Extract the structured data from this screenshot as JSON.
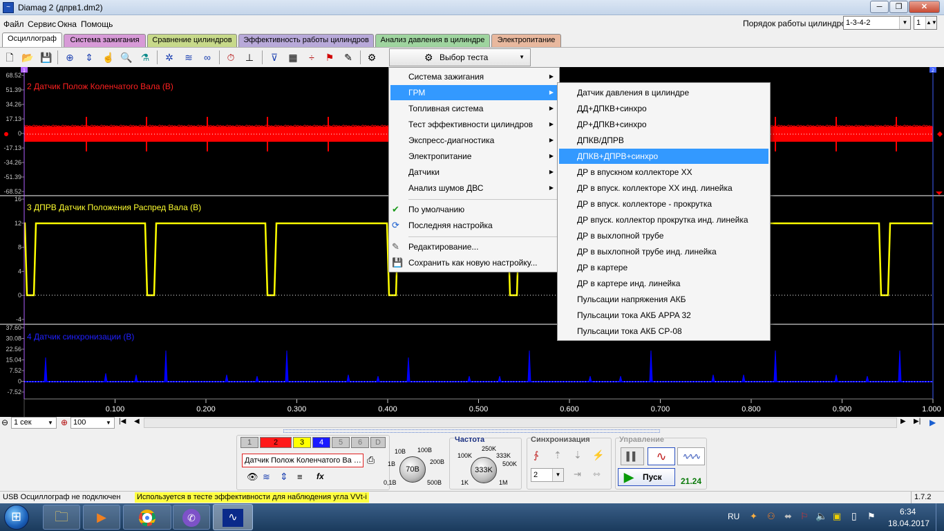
{
  "window": {
    "title": "Diamag 2 (дпрв1.dm2)",
    "minimize": "─",
    "maximize": "❐",
    "close": "✕"
  },
  "menubar": {
    "file": "Файл",
    "service": "Сервис",
    "windows": "Окна",
    "help": "Помощь"
  },
  "cylinder_order": {
    "label": "Порядок работы цилиндров",
    "value": "1-3-4-2",
    "count": "1"
  },
  "tabs": [
    {
      "label": "Осциллограф",
      "color": "#ffffff"
    },
    {
      "label": "Система зажигания",
      "color": "#d79ad7"
    },
    {
      "label": "Сравнение цилиндров",
      "color": "#c7d98a"
    },
    {
      "label": "Эффективность работы цилиндров",
      "color": "#b8a9d9"
    },
    {
      "label": "Анализ давления в цилиндре",
      "color": "#9fd49f"
    },
    {
      "label": "Электропитание",
      "color": "#e8b89e"
    }
  ],
  "test_select": {
    "label": "Выбор теста",
    "icon": "gear-icon"
  },
  "channels": {
    "ch2": {
      "title": "2 Датчик Полож Коленчатого Вала (В)",
      "color": "#ff0000",
      "yticks": [
        "68.52",
        "51.39",
        "34.26",
        "17.13",
        "0",
        "-17.13",
        "-34.26",
        "-51.39",
        "-68.52"
      ]
    },
    "ch3": {
      "title": "3 ДПРВ Датчик Положения Распред Вала (В)",
      "color": "#ffff00",
      "yticks": [
        "16",
        "12",
        "8",
        "4",
        "0",
        "-4"
      ]
    },
    "ch4": {
      "title": "4 Датчик синхронизации (В)",
      "color": "#0000ff",
      "yticks": [
        "37.60",
        "30.08",
        "22.56",
        "15.04",
        "7.52",
        "0",
        "-7.52"
      ]
    },
    "marker_left": "1",
    "marker_right": "2"
  },
  "xaxis": {
    "ticks": [
      "0.100",
      "0.200",
      "0.300",
      "0.400",
      "0.500",
      "0.600",
      "0.700",
      "0.800",
      "0.900",
      "1.000"
    ]
  },
  "scale": {
    "time": "1 сек",
    "zoom": "100"
  },
  "context_menu": {
    "items": [
      {
        "label": "Система зажигания",
        "submenu": true
      },
      {
        "label": "ГРМ",
        "submenu": true,
        "highlighted": true
      },
      {
        "label": "Топливная система",
        "submenu": true
      },
      {
        "label": "Тест эффективности цилиндров",
        "submenu": true
      },
      {
        "label": "Экспресс-диагностика",
        "submenu": true
      },
      {
        "label": "Электропитание",
        "submenu": true
      },
      {
        "label": "Датчики",
        "submenu": true
      },
      {
        "label": "Анализ шумов ДВС",
        "submenu": true
      }
    ],
    "actions": [
      {
        "label": "По умолчанию",
        "icon": "check-icon"
      },
      {
        "label": "Последняя настройка",
        "icon": "refresh-icon"
      },
      {
        "label": "Редактирование...",
        "icon": "edit-icon"
      },
      {
        "label": "Сохранить как новую настройку...",
        "icon": "save-icon"
      }
    ]
  },
  "submenu_grm": {
    "items": [
      "Датчик давления в цилиндре",
      "ДД+ДПКВ+синхро",
      "ДР+ДПКВ+синхро",
      "ДПКВ/ДПРВ",
      "ДПКВ+ДПРВ+синхро",
      "ДР в впускном коллекторе ХХ",
      "ДР в впуск. коллекторе ХХ инд. линейка",
      "ДР в впуск. коллекторе - прокрутка",
      "ДР впуск. коллектор прокрутка инд. линейка",
      "ДР в выхлопной трубе",
      "ДР в выхлопной трубе инд. линейка",
      "ДР в картере",
      "ДР в картере инд. линейка",
      "Пульсации напряжения АКБ",
      "Пульсации тока АКБ APPA 32",
      "Пульсации тока АКБ CP-08"
    ],
    "highlighted_index": 4
  },
  "channel_buttons": [
    "1",
    "2",
    "3",
    "4",
    "5",
    "6",
    "D"
  ],
  "channel_name_field": "Датчик Полож Коленчатого Ва",
  "voltage_knob": {
    "value": "70В",
    "labels": [
      "10В",
      "100В",
      "1В",
      "200В",
      "0,1В",
      "500В"
    ]
  },
  "frequency": {
    "title": "Частота",
    "value": "333K",
    "labels": [
      "100K",
      "250K",
      "333K",
      "500K",
      "1K",
      "1M"
    ]
  },
  "sync": {
    "title": "Синхронизация",
    "value": "2"
  },
  "control": {
    "title": "Управление",
    "start": "Пуск",
    "readout": "21.24"
  },
  "status": {
    "connection": "USB Осциллограф не подключен",
    "hint": "Используется в тесте эффективности для наблюдения угла VVt-i",
    "version": "1.7.2"
  },
  "taskbar": {
    "lang": "RU",
    "time": "6:34",
    "date": "18.04.2017"
  }
}
